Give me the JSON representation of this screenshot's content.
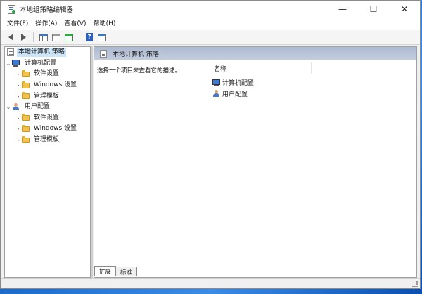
{
  "window": {
    "title": "本地组策略编辑器"
  },
  "window_controls": {
    "minimize": "—",
    "maximize": "☐",
    "close": "✕"
  },
  "menu": [
    "文件(F)",
    "操作(A)",
    "查看(V)",
    "帮助(H)"
  ],
  "tree": {
    "root": "本地计算机 策略",
    "computer": "计算机配置",
    "computer_children": [
      "软件设置",
      "Windows 设置",
      "管理模板"
    ],
    "user": "用户配置",
    "user_children": [
      "软件设置",
      "Windows 设置",
      "管理模板"
    ]
  },
  "detail": {
    "header": "本地计算机 策略",
    "description": "选择一个项目来查看它的描述。",
    "column_name": "名称",
    "items": [
      "计算机配置",
      "用户配置"
    ]
  },
  "tabs": [
    "扩展",
    "标准"
  ],
  "toolbar_icons": [
    "back-icon",
    "forward-icon",
    "show-hide-tree-icon",
    "properties-icon",
    "export-list-icon",
    "help-icon",
    "view-icon"
  ]
}
